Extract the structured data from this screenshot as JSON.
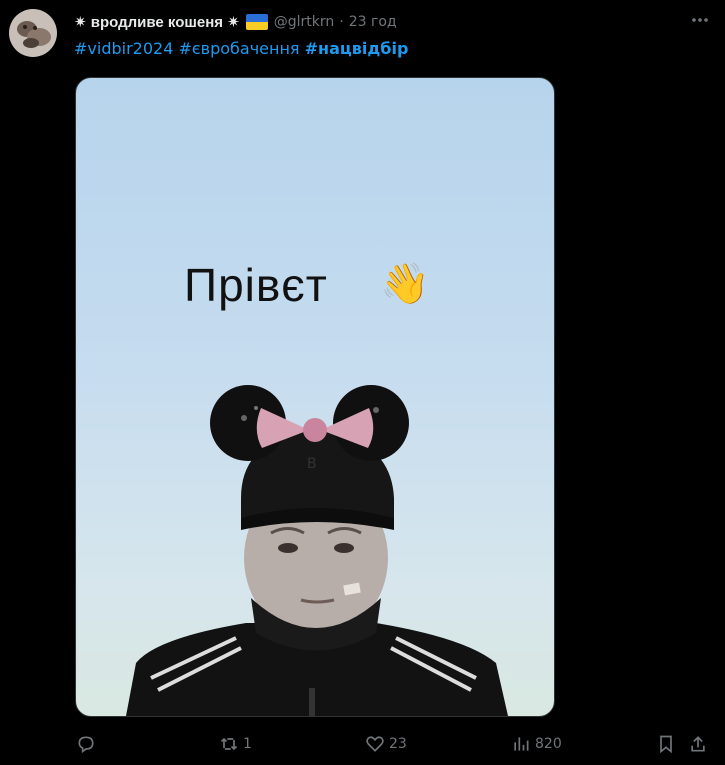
{
  "tweet": {
    "display_name": "✷ вродливе кошеня ✷",
    "flag_emoji": "🇺🇦",
    "handle": "@glrtkrn",
    "separator": "·",
    "time": "23 год",
    "more_icon": "more-horizontal-icon",
    "hashtags": [
      "#vidbir2024",
      "#євробачення",
      "#нацвідбір"
    ],
    "media": {
      "caption": "Прівєт",
      "emoji": "👋"
    },
    "actions": {
      "reply_count": "",
      "retweet_count": "1",
      "like_count": "23",
      "views_count": "820"
    }
  },
  "colors": {
    "background": "#000000",
    "link": "#1d9bf0",
    "muted": "#71767b",
    "text": "#e7e9ea"
  }
}
